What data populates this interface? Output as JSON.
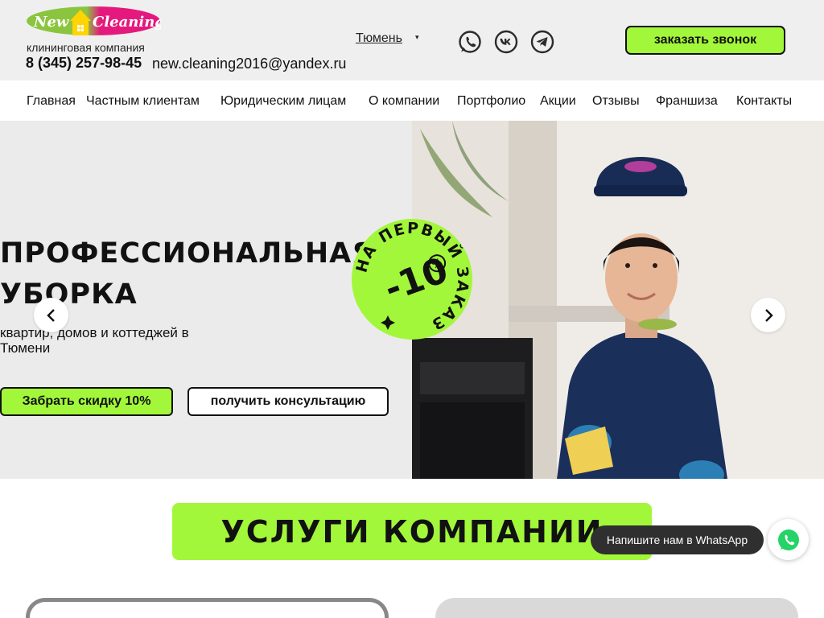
{
  "header": {
    "logo_text": "New Cleaning",
    "tagline": "клининговая компания",
    "phone": "8 (345) 257-98-45",
    "email": "new.cleaning2016@yandex.ru",
    "city": "Тюмень",
    "city_caret": "▾",
    "social_icons": [
      "whatsapp-icon",
      "vk-icon",
      "telegram-icon"
    ],
    "callback_label": "заказать звонок"
  },
  "nav": {
    "items": [
      {
        "label": "Главная"
      },
      {
        "label": "Частным клиентам"
      },
      {
        "label": "Юридическим лицам"
      },
      {
        "label": "О компании"
      },
      {
        "label": "Портфолио"
      },
      {
        "label": "Акции"
      },
      {
        "label": "Отзывы"
      },
      {
        "label": "Франшиза"
      },
      {
        "label": "Контакты"
      }
    ]
  },
  "hero": {
    "title_line1": "ПРОФЕССИОНАЛЬНАЯ",
    "title_line2": "УБОРКА",
    "subtitle": "квартир, домов и коттеджей в Тюмени",
    "discount_button": "Забрать скидку 10%",
    "consult_button": "получить консультацию",
    "badge_value": "-10",
    "badge_percent": "%",
    "badge_ring_text": "НА ПЕРВЫЙ ЗАКАЗ"
  },
  "services": {
    "title": "УСЛУГИ КОМПАНИИ"
  },
  "whatsapp_widget": {
    "tooltip": "Напишите нам в WhatsApp"
  },
  "colors": {
    "accent": "#a2f73a",
    "header_bg": "#efefef",
    "hero_bg": "#ebebeb",
    "logo_green": "#8bc53f",
    "logo_pink": "#e5187d",
    "logo_yellow": "#ffd400"
  }
}
